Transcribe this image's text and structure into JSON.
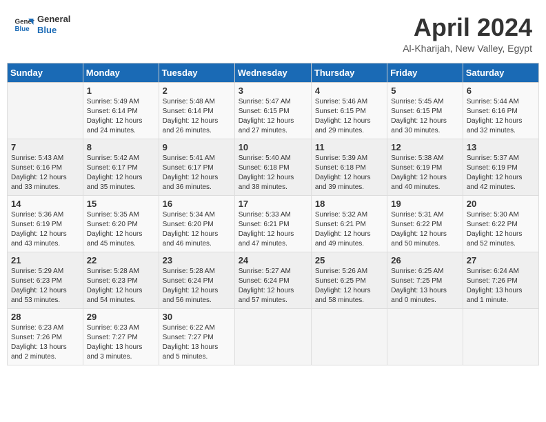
{
  "logo": {
    "text_general": "General",
    "text_blue": "Blue"
  },
  "header": {
    "title": "April 2024",
    "subtitle": "Al-Kharijah, New Valley, Egypt"
  },
  "columns": [
    "Sunday",
    "Monday",
    "Tuesday",
    "Wednesday",
    "Thursday",
    "Friday",
    "Saturday"
  ],
  "weeks": [
    [
      {
        "day": "",
        "info": ""
      },
      {
        "day": "1",
        "info": "Sunrise: 5:49 AM\nSunset: 6:14 PM\nDaylight: 12 hours\nand 24 minutes."
      },
      {
        "day": "2",
        "info": "Sunrise: 5:48 AM\nSunset: 6:14 PM\nDaylight: 12 hours\nand 26 minutes."
      },
      {
        "day": "3",
        "info": "Sunrise: 5:47 AM\nSunset: 6:15 PM\nDaylight: 12 hours\nand 27 minutes."
      },
      {
        "day": "4",
        "info": "Sunrise: 5:46 AM\nSunset: 6:15 PM\nDaylight: 12 hours\nand 29 minutes."
      },
      {
        "day": "5",
        "info": "Sunrise: 5:45 AM\nSunset: 6:15 PM\nDaylight: 12 hours\nand 30 minutes."
      },
      {
        "day": "6",
        "info": "Sunrise: 5:44 AM\nSunset: 6:16 PM\nDaylight: 12 hours\nand 32 minutes."
      }
    ],
    [
      {
        "day": "7",
        "info": "Sunrise: 5:43 AM\nSunset: 6:16 PM\nDaylight: 12 hours\nand 33 minutes."
      },
      {
        "day": "8",
        "info": "Sunrise: 5:42 AM\nSunset: 6:17 PM\nDaylight: 12 hours\nand 35 minutes."
      },
      {
        "day": "9",
        "info": "Sunrise: 5:41 AM\nSunset: 6:17 PM\nDaylight: 12 hours\nand 36 minutes."
      },
      {
        "day": "10",
        "info": "Sunrise: 5:40 AM\nSunset: 6:18 PM\nDaylight: 12 hours\nand 38 minutes."
      },
      {
        "day": "11",
        "info": "Sunrise: 5:39 AM\nSunset: 6:18 PM\nDaylight: 12 hours\nand 39 minutes."
      },
      {
        "day": "12",
        "info": "Sunrise: 5:38 AM\nSunset: 6:19 PM\nDaylight: 12 hours\nand 40 minutes."
      },
      {
        "day": "13",
        "info": "Sunrise: 5:37 AM\nSunset: 6:19 PM\nDaylight: 12 hours\nand 42 minutes."
      }
    ],
    [
      {
        "day": "14",
        "info": "Sunrise: 5:36 AM\nSunset: 6:19 PM\nDaylight: 12 hours\nand 43 minutes."
      },
      {
        "day": "15",
        "info": "Sunrise: 5:35 AM\nSunset: 6:20 PM\nDaylight: 12 hours\nand 45 minutes."
      },
      {
        "day": "16",
        "info": "Sunrise: 5:34 AM\nSunset: 6:20 PM\nDaylight: 12 hours\nand 46 minutes."
      },
      {
        "day": "17",
        "info": "Sunrise: 5:33 AM\nSunset: 6:21 PM\nDaylight: 12 hours\nand 47 minutes."
      },
      {
        "day": "18",
        "info": "Sunrise: 5:32 AM\nSunset: 6:21 PM\nDaylight: 12 hours\nand 49 minutes."
      },
      {
        "day": "19",
        "info": "Sunrise: 5:31 AM\nSunset: 6:22 PM\nDaylight: 12 hours\nand 50 minutes."
      },
      {
        "day": "20",
        "info": "Sunrise: 5:30 AM\nSunset: 6:22 PM\nDaylight: 12 hours\nand 52 minutes."
      }
    ],
    [
      {
        "day": "21",
        "info": "Sunrise: 5:29 AM\nSunset: 6:23 PM\nDaylight: 12 hours\nand 53 minutes."
      },
      {
        "day": "22",
        "info": "Sunrise: 5:28 AM\nSunset: 6:23 PM\nDaylight: 12 hours\nand 54 minutes."
      },
      {
        "day": "23",
        "info": "Sunrise: 5:28 AM\nSunset: 6:24 PM\nDaylight: 12 hours\nand 56 minutes."
      },
      {
        "day": "24",
        "info": "Sunrise: 5:27 AM\nSunset: 6:24 PM\nDaylight: 12 hours\nand 57 minutes."
      },
      {
        "day": "25",
        "info": "Sunrise: 5:26 AM\nSunset: 6:25 PM\nDaylight: 12 hours\nand 58 minutes."
      },
      {
        "day": "26",
        "info": "Sunrise: 6:25 AM\nSunset: 7:25 PM\nDaylight: 13 hours\nand 0 minutes."
      },
      {
        "day": "27",
        "info": "Sunrise: 6:24 AM\nSunset: 7:26 PM\nDaylight: 13 hours\nand 1 minute."
      }
    ],
    [
      {
        "day": "28",
        "info": "Sunrise: 6:23 AM\nSunset: 7:26 PM\nDaylight: 13 hours\nand 2 minutes."
      },
      {
        "day": "29",
        "info": "Sunrise: 6:23 AM\nSunset: 7:27 PM\nDaylight: 13 hours\nand 3 minutes."
      },
      {
        "day": "30",
        "info": "Sunrise: 6:22 AM\nSunset: 7:27 PM\nDaylight: 13 hours\nand 5 minutes."
      },
      {
        "day": "",
        "info": ""
      },
      {
        "day": "",
        "info": ""
      },
      {
        "day": "",
        "info": ""
      },
      {
        "day": "",
        "info": ""
      }
    ]
  ]
}
